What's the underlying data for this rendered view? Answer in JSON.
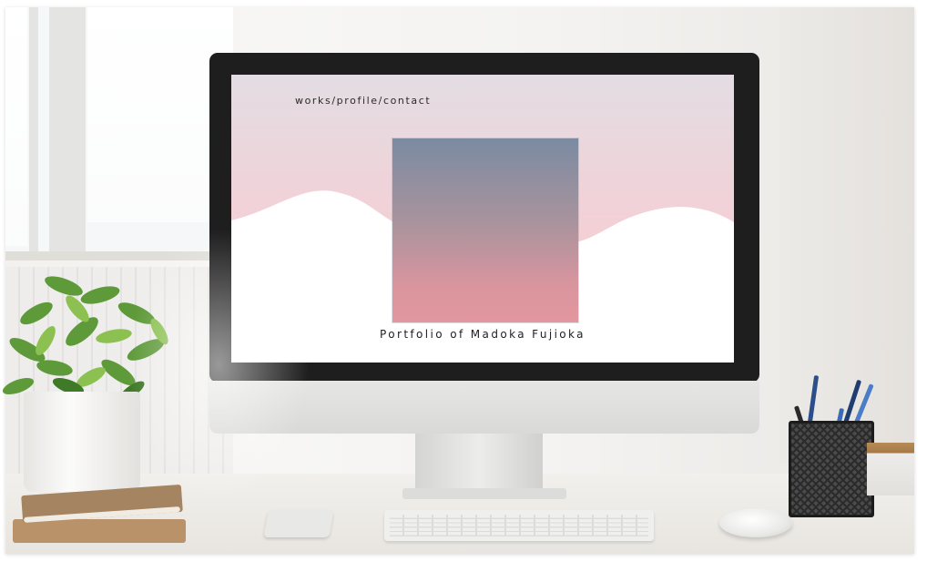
{
  "screen": {
    "nav": {
      "works": "works",
      "profile": "profile",
      "contact": "contact",
      "separator": "/"
    },
    "caption": "Portfolio of Madoka Fujioka",
    "colors": {
      "sky_top": "#e3dde3",
      "sky_bottom": "#f7cdd2",
      "wave": "#ffffff",
      "square_top": "#7b8ba2",
      "square_bottom": "#e3979f",
      "text": "#2a2a2a"
    }
  }
}
